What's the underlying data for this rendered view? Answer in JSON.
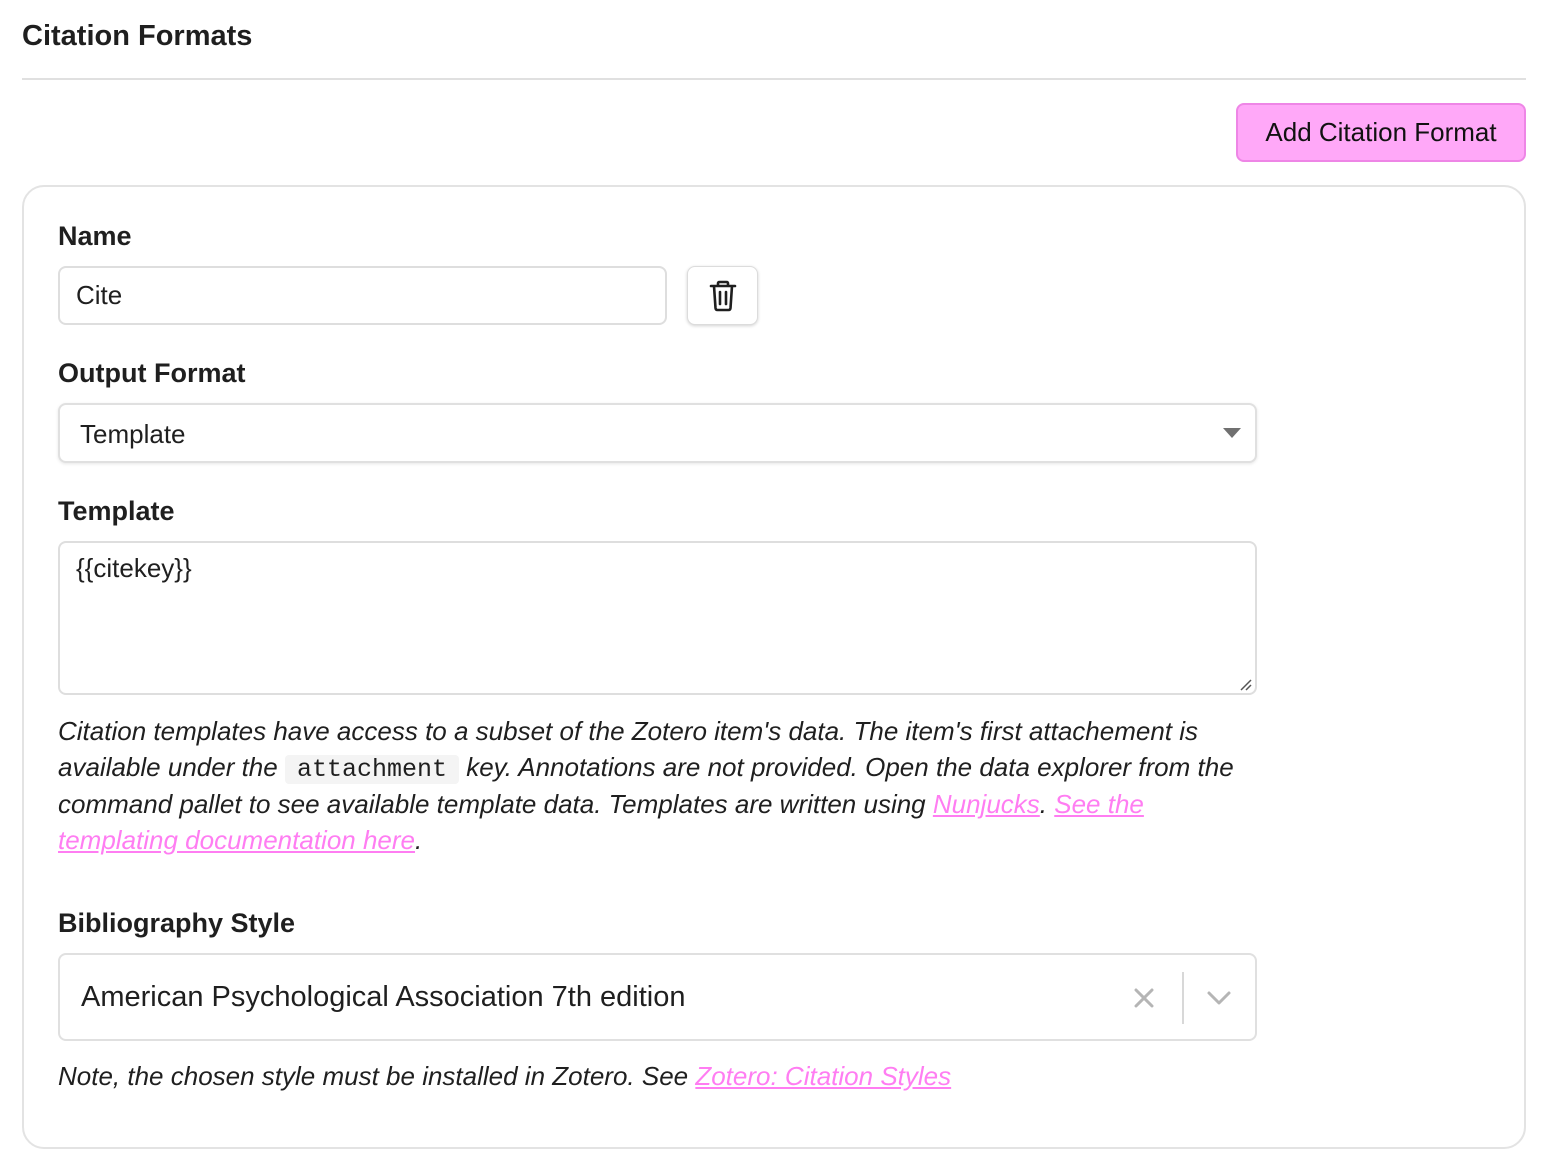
{
  "section": {
    "title": "Citation Formats",
    "add_button_label": "Add Citation Format"
  },
  "format": {
    "name_label": "Name",
    "name_value": "Cite",
    "delete_icon": "trash-icon",
    "output_format_label": "Output Format",
    "output_format_value": "Template",
    "template_label": "Template",
    "template_value": "{{citekey}}",
    "help": {
      "part1": "Citation templates have access to a subset of the Zotero item's data. The item's first attachement is available under the ",
      "code": "attachment",
      "part2": " key. Annotations are not provided. Open the data explorer from the command pallet to see available template data. Templates are written using ",
      "link1": "Nunjucks",
      "sep": ". ",
      "link2": "See the templating documentation here",
      "end": "."
    },
    "bibliography_label": "Bibliography Style",
    "bibliography_value": "American Psychological Association 7th edition",
    "note": {
      "text": "Note, the chosen style must be installed in Zotero. See ",
      "link": "Zotero: Citation Styles"
    }
  },
  "colors": {
    "accent": "#ffa8f8",
    "accent_border": "#ee86e6",
    "link": "#ff7df2"
  }
}
